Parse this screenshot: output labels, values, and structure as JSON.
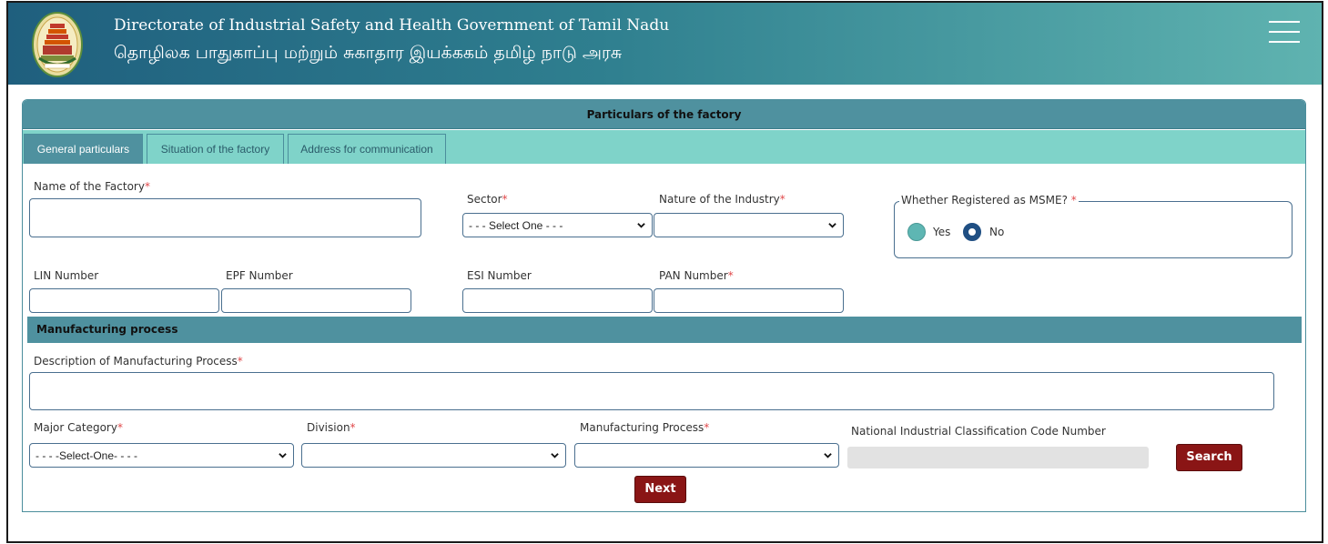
{
  "header": {
    "title_en": "Directorate of Industrial Safety and Health Government of Tamil Nadu",
    "title_ta": "தொழிலக பாதுகாப்பு மற்றும் சுகாதார இயக்ககம் தமிழ் நாடு அரசு",
    "logo_icon": "tamil-nadu-emblem",
    "menu_icon": "hamburger-icon"
  },
  "card": {
    "title": "Particulars of the factory",
    "tabs": [
      {
        "label": "General particulars",
        "active": true
      },
      {
        "label": "Situation of the factory",
        "active": false
      },
      {
        "label": "Address for communication",
        "active": false
      }
    ]
  },
  "form": {
    "factory_name": {
      "label": "Name of the Factory",
      "value": ""
    },
    "sector": {
      "label": "Sector",
      "selected": "- - - Select One - - -"
    },
    "nature": {
      "label": "Nature of the Industry",
      "selected": ""
    },
    "msme": {
      "legend": "Whether Registered as MSME? ",
      "yes": "Yes",
      "no": "No",
      "selected": "No"
    },
    "lin": {
      "label": "LIN Number",
      "value": ""
    },
    "epf": {
      "label": "EPF Number",
      "value": ""
    },
    "esi": {
      "label": "ESI Number",
      "value": ""
    },
    "pan": {
      "label": "PAN Number",
      "value": ""
    },
    "required_mark": "*"
  },
  "manufacturing": {
    "section_title": "Manufacturing process",
    "description": {
      "label": "Description of Manufacturing Process",
      "value": ""
    },
    "major_category": {
      "label": "Major Category",
      "selected": "- - - -Select-One- - - -"
    },
    "division": {
      "label": "Division",
      "selected": ""
    },
    "process": {
      "label": "Manufacturing Process",
      "selected": ""
    },
    "nic": {
      "label": "National Industrial Classification Code Number",
      "value": ""
    },
    "search_label": "Search",
    "next_label": "Next"
  },
  "colors": {
    "header_dark": "#1f5f7e",
    "header_light": "#5fb3b0",
    "section_bar": "#4f919f",
    "tab_bar": "#7fd3c9",
    "button": "#8a1515",
    "required": "#e0484a"
  }
}
